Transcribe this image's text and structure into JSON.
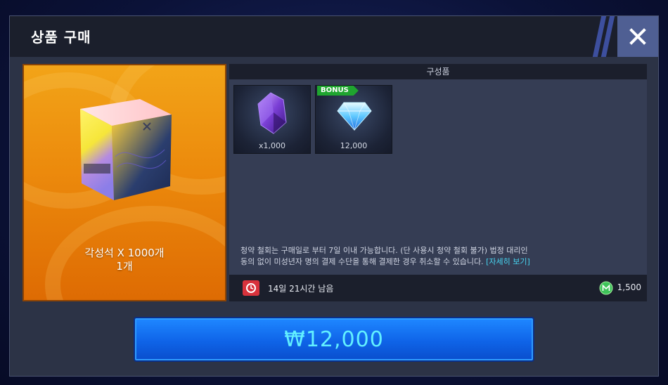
{
  "window": {
    "title": "상품 구매",
    "close_icon": "close-icon"
  },
  "product": {
    "name": "각성석 X 1000개",
    "count": "1개",
    "image": "gradient-box-icon"
  },
  "contents": {
    "header": "구성품",
    "items": [
      {
        "icon": "purple-crystal-icon",
        "quantity": "x1,000",
        "bonus": false
      },
      {
        "icon": "blue-diamond-icon",
        "quantity": "12,000",
        "bonus": true,
        "bonus_label": "BONUS"
      }
    ],
    "notice_line1": "청약 철회는 구매일로 부터 7일 이내 가능합니다. (단 사용시 청약 철회 불가) 법정 대리인",
    "notice_line2": "동의 없이 미성년자 명의 결제 수단을 통해 결제한 경우 취소할 수 있습니다.",
    "notice_link": "[자세히 보기]"
  },
  "footer": {
    "time_left": "14일 21시간 남음",
    "mileage_value": "1,500"
  },
  "buy_button": {
    "price": "₩12,000"
  },
  "colors": {
    "accent_blue": "#1e86ff",
    "price_text": "#62f0ff",
    "link": "#47d4f0",
    "bonus_green": "#1fa52f",
    "timer_red": "#d8323c",
    "card_orange": "#ec8a0c"
  }
}
